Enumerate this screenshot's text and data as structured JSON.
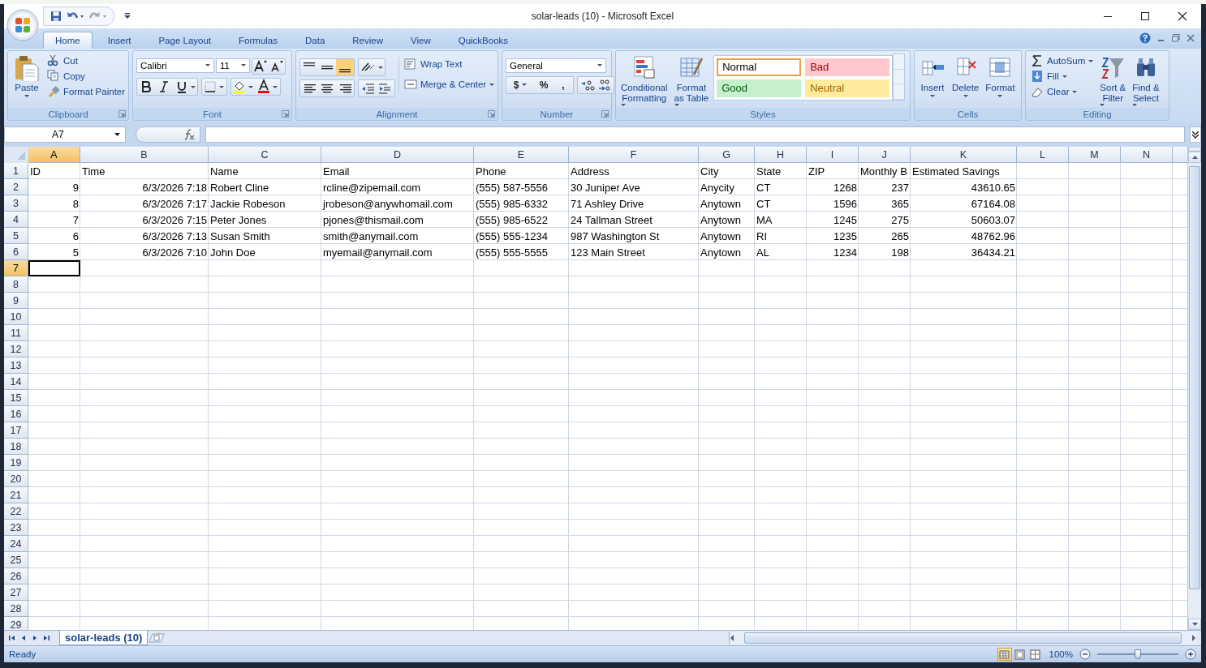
{
  "window": {
    "title": "solar-leads (10)  -  Microsoft Excel"
  },
  "ribbon": {
    "tabs": [
      {
        "label": "Home",
        "selected": true
      },
      {
        "label": "Insert",
        "selected": false
      },
      {
        "label": "Page Layout",
        "selected": false
      },
      {
        "label": "Formulas",
        "selected": false
      },
      {
        "label": "Data",
        "selected": false
      },
      {
        "label": "Review",
        "selected": false
      },
      {
        "label": "View",
        "selected": false
      },
      {
        "label": "QuickBooks",
        "selected": false
      }
    ],
    "groups": [
      {
        "kind": "clipboard",
        "name": "Clipboard",
        "big": "Paste",
        "small": [
          "Cut",
          "Copy",
          "Format Painter"
        ]
      },
      {
        "kind": "font",
        "name": "Font",
        "font_name": "Calibri",
        "font_size": "11"
      },
      {
        "kind": "alignment",
        "name": "Alignment",
        "small": [
          "Wrap Text",
          "Merge & Center"
        ]
      },
      {
        "kind": "number",
        "name": "Number",
        "format": "General",
        "symbols": [
          "$",
          "%",
          ","
        ]
      },
      {
        "kind": "styles",
        "name": "Styles",
        "big": [
          [
            "Conditional",
            "Formatting"
          ],
          [
            "Format",
            "as Table"
          ]
        ],
        "cell_styles": [
          {
            "label": "Normal",
            "color": "#ffffff",
            "selected": true
          },
          {
            "label": "Bad",
            "color": "#ffc7ce",
            "selected": false
          },
          {
            "label": "Good",
            "color": "#c6efce",
            "selected": false
          },
          {
            "label": "Neutral",
            "color": "#ffeb9c",
            "selected": false
          }
        ]
      },
      {
        "kind": "cells",
        "name": "Cells",
        "big": [
          "Insert",
          "Delete",
          "Format"
        ]
      },
      {
        "kind": "editing",
        "name": "Editing",
        "small": [
          "AutoSum",
          "Fill",
          "Clear"
        ],
        "big": [
          [
            "Sort &",
            "Filter"
          ],
          [
            "Find &",
            "Select"
          ]
        ]
      }
    ]
  },
  "formula_bar": {
    "name_box": "A7"
  },
  "sheet": {
    "columns": [
      {
        "letter": "A",
        "selected": true,
        "numeric": true
      },
      {
        "letter": "B",
        "selected": false,
        "numeric": true
      },
      {
        "letter": "C",
        "selected": false,
        "numeric": false
      },
      {
        "letter": "D",
        "selected": false,
        "numeric": false
      },
      {
        "letter": "E",
        "selected": false,
        "numeric": false
      },
      {
        "letter": "F",
        "selected": false,
        "numeric": false
      },
      {
        "letter": "G",
        "selected": false,
        "numeric": false
      },
      {
        "letter": "H",
        "selected": false,
        "numeric": false
      },
      {
        "letter": "I",
        "selected": false,
        "numeric": true
      },
      {
        "letter": "J",
        "selected": false,
        "numeric": true
      },
      {
        "letter": "K",
        "selected": false,
        "numeric": true
      },
      {
        "letter": "L",
        "selected": false
      },
      {
        "letter": "M",
        "selected": false
      },
      {
        "letter": "N",
        "selected": false
      }
    ],
    "rows": [
      {
        "label": "1",
        "selected": false,
        "cells": [
          "ID",
          "Time",
          "Name",
          "Email",
          "Phone",
          "Address",
          "City",
          "State",
          "ZIP",
          "Monthly B",
          "Estimated Savings"
        ]
      },
      {
        "label": "2",
        "selected": false,
        "cells": [
          "9",
          "6/3/2026 7:18",
          "Robert Cline",
          "rcline@zipemail.com",
          "(555) 587-5556",
          "30 Juniper Ave",
          "Anycity",
          "CT",
          "1268",
          "237",
          "43610.65"
        ]
      },
      {
        "label": "3",
        "selected": false,
        "cells": [
          "8",
          "6/3/2026 7:17",
          "Jackie Robeson",
          "jrobeson@anywhomail.com",
          "(555) 985-6332",
          "71 Ashley Drive",
          "Anytown",
          "CT",
          "1596",
          "365",
          "67164.08"
        ]
      },
      {
        "label": "4",
        "selected": false,
        "cells": [
          "7",
          "6/3/2026 7:15",
          "Peter Jones",
          "pjones@thismail.com",
          "(555) 985-6522",
          "24 Tallman Street",
          "Anytown",
          "MA",
          "1245",
          "275",
          "50603.07"
        ]
      },
      {
        "label": "5",
        "selected": false,
        "cells": [
          "6",
          "6/3/2026 7:13",
          "Susan Smith",
          "smith@anymail.com",
          "(555) 555-1234",
          "987 Washington St",
          "Anytown",
          "RI",
          "1235",
          "265",
          "48762.96"
        ]
      },
      {
        "label": "6",
        "selected": false,
        "cells": [
          "5",
          "6/3/2026 7:10",
          "John Doe",
          "myemail@anymail.com",
          "(555) 555-5555",
          "123 Main Street",
          "Anytown",
          "AL",
          "1234",
          "198",
          "36434.21"
        ]
      },
      {
        "label": "7",
        "selected": true,
        "cells": []
      },
      {
        "label": "8",
        "selected": false,
        "cells": []
      },
      {
        "label": "9",
        "selected": false,
        "cells": []
      },
      {
        "label": "10",
        "selected": false,
        "cells": []
      },
      {
        "label": "11",
        "selected": false,
        "cells": []
      },
      {
        "label": "12",
        "selected": false,
        "cells": []
      },
      {
        "label": "13",
        "selected": false,
        "cells": []
      },
      {
        "label": "14",
        "selected": false,
        "cells": []
      },
      {
        "label": "15",
        "selected": false,
        "cells": []
      },
      {
        "label": "16",
        "selected": false,
        "cells": []
      },
      {
        "label": "17",
        "selected": false,
        "cells": []
      },
      {
        "label": "18",
        "selected": false,
        "cells": []
      },
      {
        "label": "19",
        "selected": false,
        "cells": []
      },
      {
        "label": "20",
        "selected": false,
        "cells": []
      },
      {
        "label": "21",
        "selected": false,
        "cells": []
      },
      {
        "label": "22",
        "selected": false,
        "cells": []
      },
      {
        "label": "23",
        "selected": false,
        "cells": []
      },
      {
        "label": "24",
        "selected": false,
        "cells": []
      },
      {
        "label": "25",
        "selected": false,
        "cells": []
      },
      {
        "label": "26",
        "selected": false,
        "cells": []
      },
      {
        "label": "27",
        "selected": false,
        "cells": []
      },
      {
        "label": "28",
        "selected": false,
        "cells": []
      },
      {
        "label": "29",
        "selected": false,
        "cells": []
      }
    ]
  },
  "sheet_tabs": [
    {
      "label": "solar-leads (10)",
      "selected": true
    }
  ],
  "status_bar": {
    "status": "Ready",
    "views": [
      {
        "selected": true
      },
      {
        "selected": false
      },
      {
        "selected": false
      }
    ],
    "zoom": "100%",
    "zoom_level": {
      "level": 0.5
    }
  }
}
